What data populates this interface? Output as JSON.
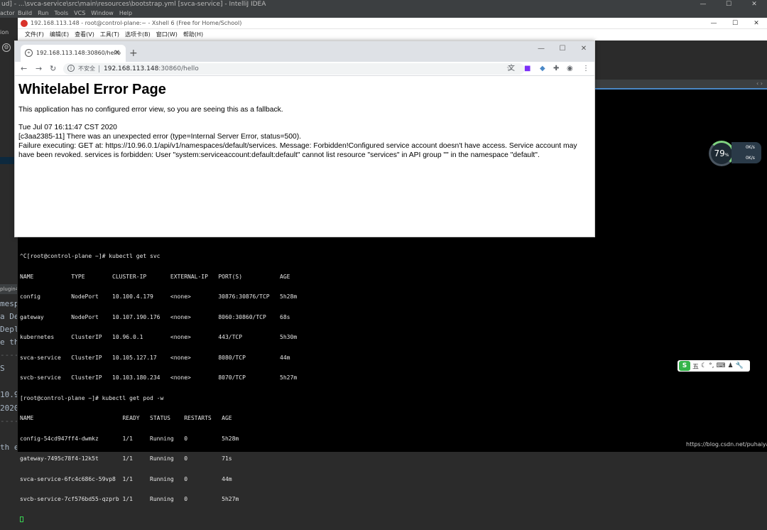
{
  "ide": {
    "title": "ud] - ...\\svca-service\\src\\main\\resources\\bootstrap.yml [svca-service] - IntelliJ IDEA",
    "menu": [
      "actor",
      "Build",
      "Run",
      "Tools",
      "VCS",
      "Window",
      "Help"
    ],
    "sidebar_tab": "ion",
    "plugin_label": "plugin4",
    "left_text": [
      "mespa",
      "a De",
      "Deplo",
      "e the",
      "----",
      "S",
      "10.9",
      "2020",
      "----",
      "th ex"
    ]
  },
  "xshell": {
    "title": "192.168.113.148 - root@control-plane:~ - Xshell 6 (Free for Home/School)",
    "menu": [
      "文件(F)",
      "编辑(E)",
      "查看(V)",
      "工具(T)",
      "选项卡(B)",
      "窗口(W)",
      "帮助(H)"
    ],
    "terminal_lines": [
      "^C[root@control-plane ~]# kubectl get svc",
      "NAME           TYPE        CLUSTER-IP       EXTERNAL-IP   PORT(S)           AGE",
      "config         NodePort    10.100.4.179     <none>        30876:30876/TCP   5h28m",
      "gateway        NodePort    10.107.190.176   <none>        8060:30860/TCP    68s",
      "kubernetes     ClusterIP   10.96.0.1        <none>        443/TCP           5h30m",
      "svca-service   ClusterIP   10.105.127.17    <none>        8080/TCP          44m",
      "svcb-service   ClusterIP   10.103.180.234   <none>        8070/TCP          5h27m",
      "[root@control-plane ~]# kubectl get pod -w",
      "NAME                          READY   STATUS    RESTARTS   AGE",
      "config-54cd947ff4-dwmkz       1/1     Running   0          5h28m",
      "gateway-7495c78f4-12k5t       1/1     Running   0          71s",
      "svca-service-6fc4c686c-59vp8  1/1     Running   0          44m",
      "svcb-service-7cf576bd55-qzprb 1/1     Running   0          5h27m"
    ]
  },
  "gauge": {
    "value": "79",
    "unit": "%",
    "up": "0K/s",
    "down": "0K/s"
  },
  "ime": {
    "label": "五"
  },
  "watermark": "https://blog.csdn.net/puhaiyang",
  "browser": {
    "tab_title": "192.168.113.148:30860/hello",
    "insecure_label": "不安全",
    "url_host": "192.168.113.148",
    "url_rest": ":30860/hello",
    "page": {
      "heading": "Whitelabel Error Page",
      "intro": "This application has no configured error view, so you are seeing this as a fallback.",
      "timestamp": "Tue Jul 07 16:11:47 CST 2020",
      "error_line": "[c3aa2385-11] There was an unexpected error (type=Internal Server Error, status=500).",
      "detail": "Failure executing: GET at: https://10.96.0.1/api/v1/namespaces/default/services. Message: Forbidden!Configured service account doesn't have access. Service account may have been revoked. services is forbidden: User \"system:serviceaccount:default:default\" cannot list resource \"services\" in API group \"\" in the namespace \"default\"."
    }
  }
}
